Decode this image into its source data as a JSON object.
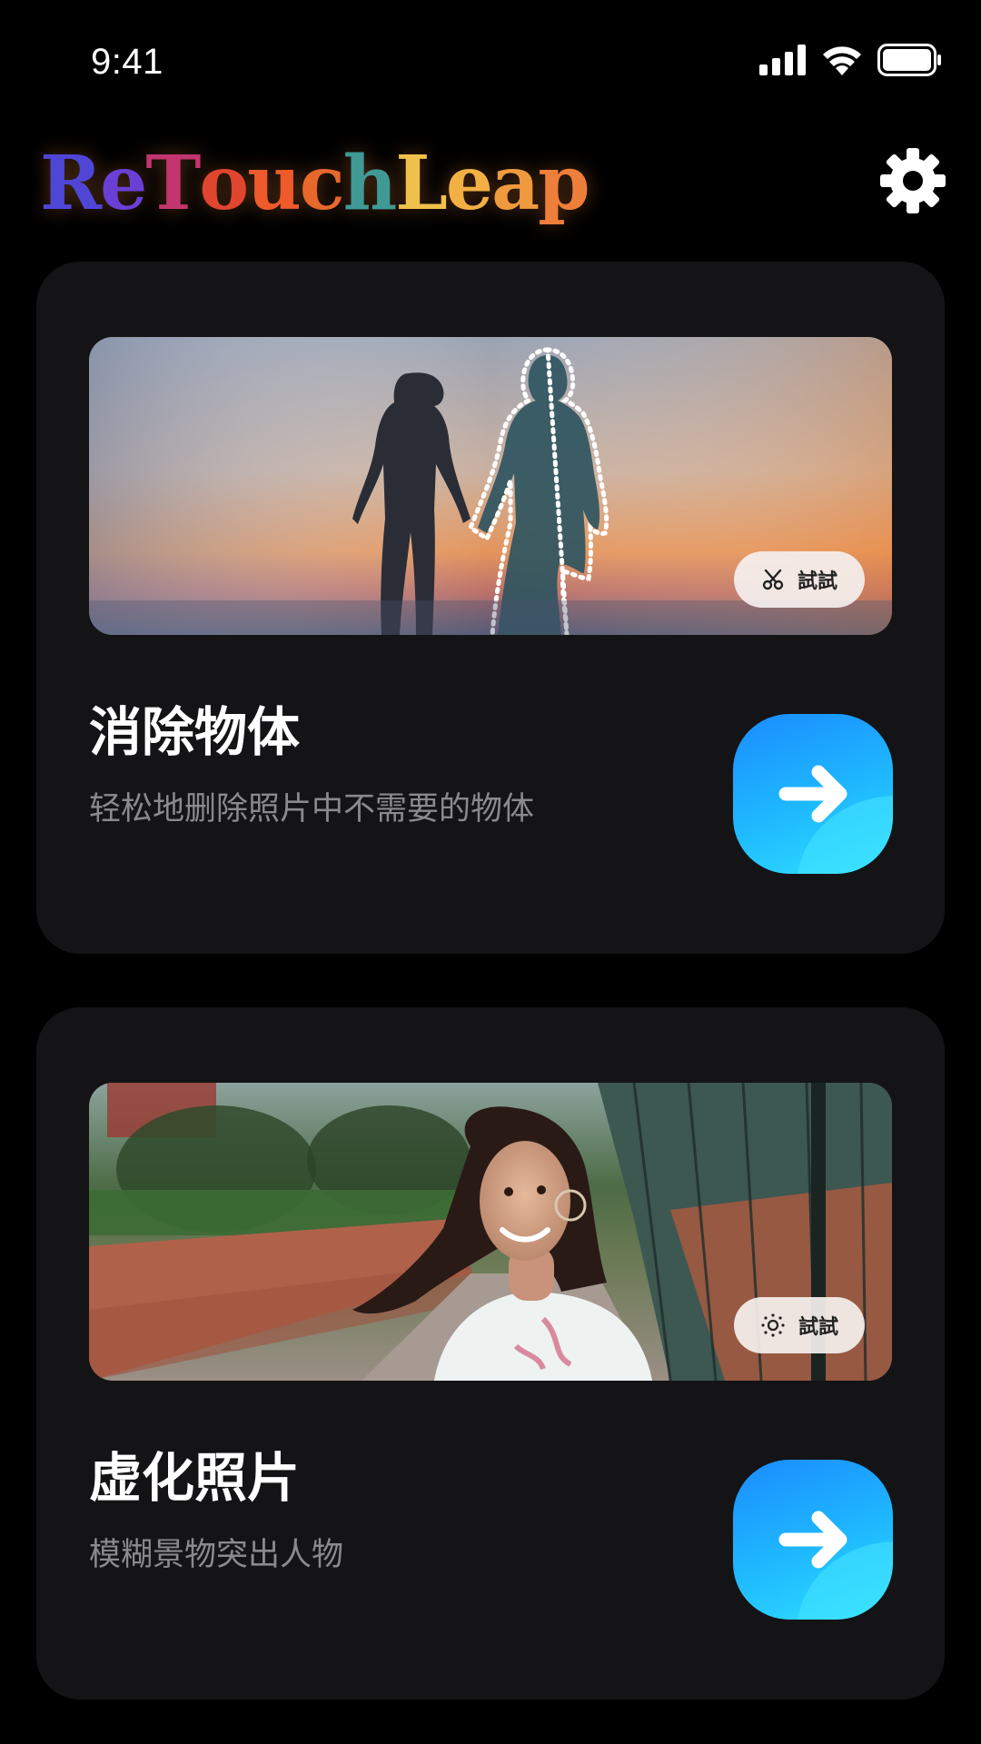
{
  "status_bar": {
    "time": "9:41"
  },
  "header": {
    "logo_letters": [
      {
        "ch": "R",
        "color": "#4f46d6"
      },
      {
        "ch": "e",
        "color": "#6a3fd6"
      },
      {
        "ch": "T",
        "color": "#c2356e"
      },
      {
        "ch": "o",
        "color": "#e0452f"
      },
      {
        "ch": "u",
        "color": "#ee5a2a"
      },
      {
        "ch": "c",
        "color": "#e8682c"
      },
      {
        "ch": "h",
        "color": "#3f9a96"
      },
      {
        "ch": "L",
        "color": "#f0c14a"
      },
      {
        "ch": "e",
        "color": "#f2b043"
      },
      {
        "ch": "a",
        "color": "#ef9a3e"
      },
      {
        "ch": "p",
        "color": "#ee7f3a"
      }
    ],
    "logo_text": "ReTouchLeap",
    "settings_icon": "gear-icon"
  },
  "cards": [
    {
      "title": "消除物体",
      "description": "轻松地删除照片中不需要的物体",
      "try_label": "試試",
      "try_icon": "eraser-scissors-icon",
      "action_icon": "arrow-right-icon"
    },
    {
      "title": "虚化照片",
      "description": "模糊景物突出人物",
      "try_label": "試試",
      "try_icon": "blur-icon",
      "action_icon": "arrow-right-icon"
    }
  ],
  "colors": {
    "background": "#000000",
    "card": "#141416",
    "accent": "#1a8cff",
    "accent_light": "#2fe0ff",
    "secondary_text": "#8a8a8e"
  }
}
